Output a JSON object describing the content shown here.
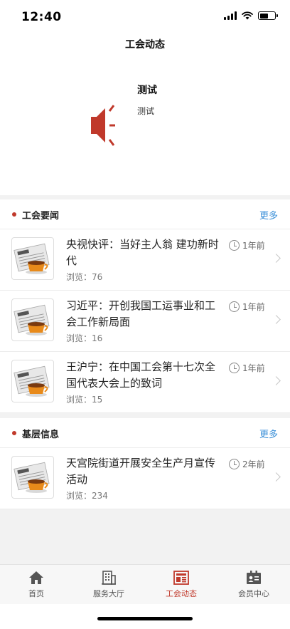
{
  "status_bar": {
    "time": "12:40"
  },
  "header": {
    "title": "工会动态"
  },
  "notice": {
    "title": "测试",
    "text": "测试",
    "icon": "speaker-icon"
  },
  "sections": [
    {
      "title": "工会要闻",
      "more": "更多",
      "items": [
        {
          "title": "央视快评：当好主人翁 建功新时代",
          "time": "1年前",
          "views": "浏览：76"
        },
        {
          "title": "习近平：开创我国工运事业和工会工作新局面",
          "time": "1年前",
          "views": "浏览：16"
        },
        {
          "title": "王沪宁：在中国工会第十七次全国代表大会上的致词",
          "time": "1年前",
          "views": "浏览：15"
        }
      ]
    },
    {
      "title": "基层信息",
      "more": "更多",
      "items": [
        {
          "title": "天宫院街道开展安全生产月宣传活动",
          "time": "2年前",
          "views": "浏览：234"
        }
      ]
    }
  ],
  "tab_bar": [
    {
      "label": "首页",
      "icon": "home-icon",
      "active": false
    },
    {
      "label": "服务大厅",
      "icon": "building-icon",
      "active": false
    },
    {
      "label": "工会动态",
      "icon": "news-icon",
      "active": true
    },
    {
      "label": "会员中心",
      "icon": "member-card-icon",
      "active": false
    }
  ],
  "colors": {
    "accent": "#c0392b",
    "link": "#3a8fd8",
    "background": "#f2f2f2"
  }
}
